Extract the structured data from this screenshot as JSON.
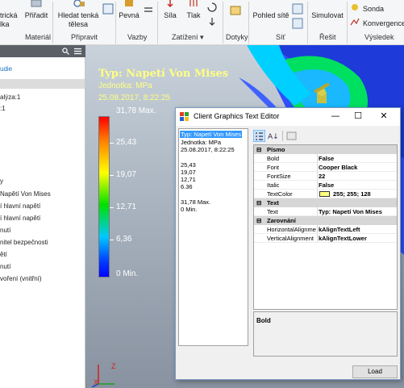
{
  "ribbon": {
    "buttons": {
      "elektricka_l1": "trická",
      "elektricka_l2": "lka",
      "priradit": "Přiřadit",
      "hledat_l1": "Hledat tenká",
      "hledat_l2": "tělesa",
      "pevna": "Pevná",
      "sila": "Síla",
      "tlak": "Tlak",
      "pohled_site": "Pohled sítě",
      "simulovat": "Simulovat",
      "sonda": "Sonda",
      "konvergence": "Konvergence"
    },
    "groups": {
      "material": "Materiál",
      "pripravit": "Připravit",
      "vazby": "Vazby",
      "zatizeni": "Zatížení",
      "zatizeni_arrow": "▾",
      "dotyky": "Dotyky",
      "sit": "Síť",
      "resit": "Řešit",
      "vysledek": "Výsledek"
    }
  },
  "browser": {
    "search_icon": "search-icon",
    "menu_icon": "menu-icon",
    "items": [
      "udie",
      "alýza:1",
      ":1",
      "y",
      "Napětí Von Mises",
      "í hlavní napětí",
      "í hlavní napětí",
      "nutí",
      "nitel bezpečnosti",
      "ětí",
      "nutí",
      "voření (vnitřní)"
    ]
  },
  "viewport": {
    "title": "Typ: Napetí Von Mises",
    "unit": "Jednotka: MPa",
    "timestamp": "25.08.2017, 8:22:25",
    "legend": {
      "max": "31,78 Max.",
      "l1": "25,43",
      "l2": "19,07",
      "l3": "12,71",
      "l4": "6,36",
      "min": "0 Min."
    },
    "triad": {
      "x": "X",
      "z": "Z"
    }
  },
  "dialog": {
    "title": "Client Graphics Text Editor",
    "minimize": "—",
    "maximize": "☐",
    "close": "✕",
    "text_lines": [
      "Typ: Napetí Von Mises",
      "Jednotka: MPa",
      "25.08.2017, 8:22:25",
      "",
      "25,43",
      "19,07",
      "12,71",
      "6.36",
      "",
      "31,78 Max.",
      "0 Min."
    ],
    "property_grid": {
      "categories": {
        "pismo": "Písmo",
        "text": "Text",
        "zarovnani": "Zarovnání"
      },
      "toggle": "⊟",
      "rows": {
        "bold": {
          "label": "Bold",
          "value": "False"
        },
        "font": {
          "label": "Font",
          "value": "Cooper Black"
        },
        "fontsize": {
          "label": "FontSize",
          "value": "22"
        },
        "italic": {
          "label": "Italic",
          "value": "False"
        },
        "textcolor": {
          "label": "TextColor",
          "value": "255; 255; 128"
        },
        "text": {
          "label": "Text",
          "value": "Typ: Napetí Von Mises"
        },
        "halign": {
          "label": "HorizontalAlignme",
          "value": "kAlignTextLeft"
        },
        "valign": {
          "label": "VerticalAlignment",
          "value": "kAlignTextLower"
        }
      },
      "color_swatch": "#ffff80"
    },
    "description_title": "Bold",
    "load_button": "Load"
  }
}
